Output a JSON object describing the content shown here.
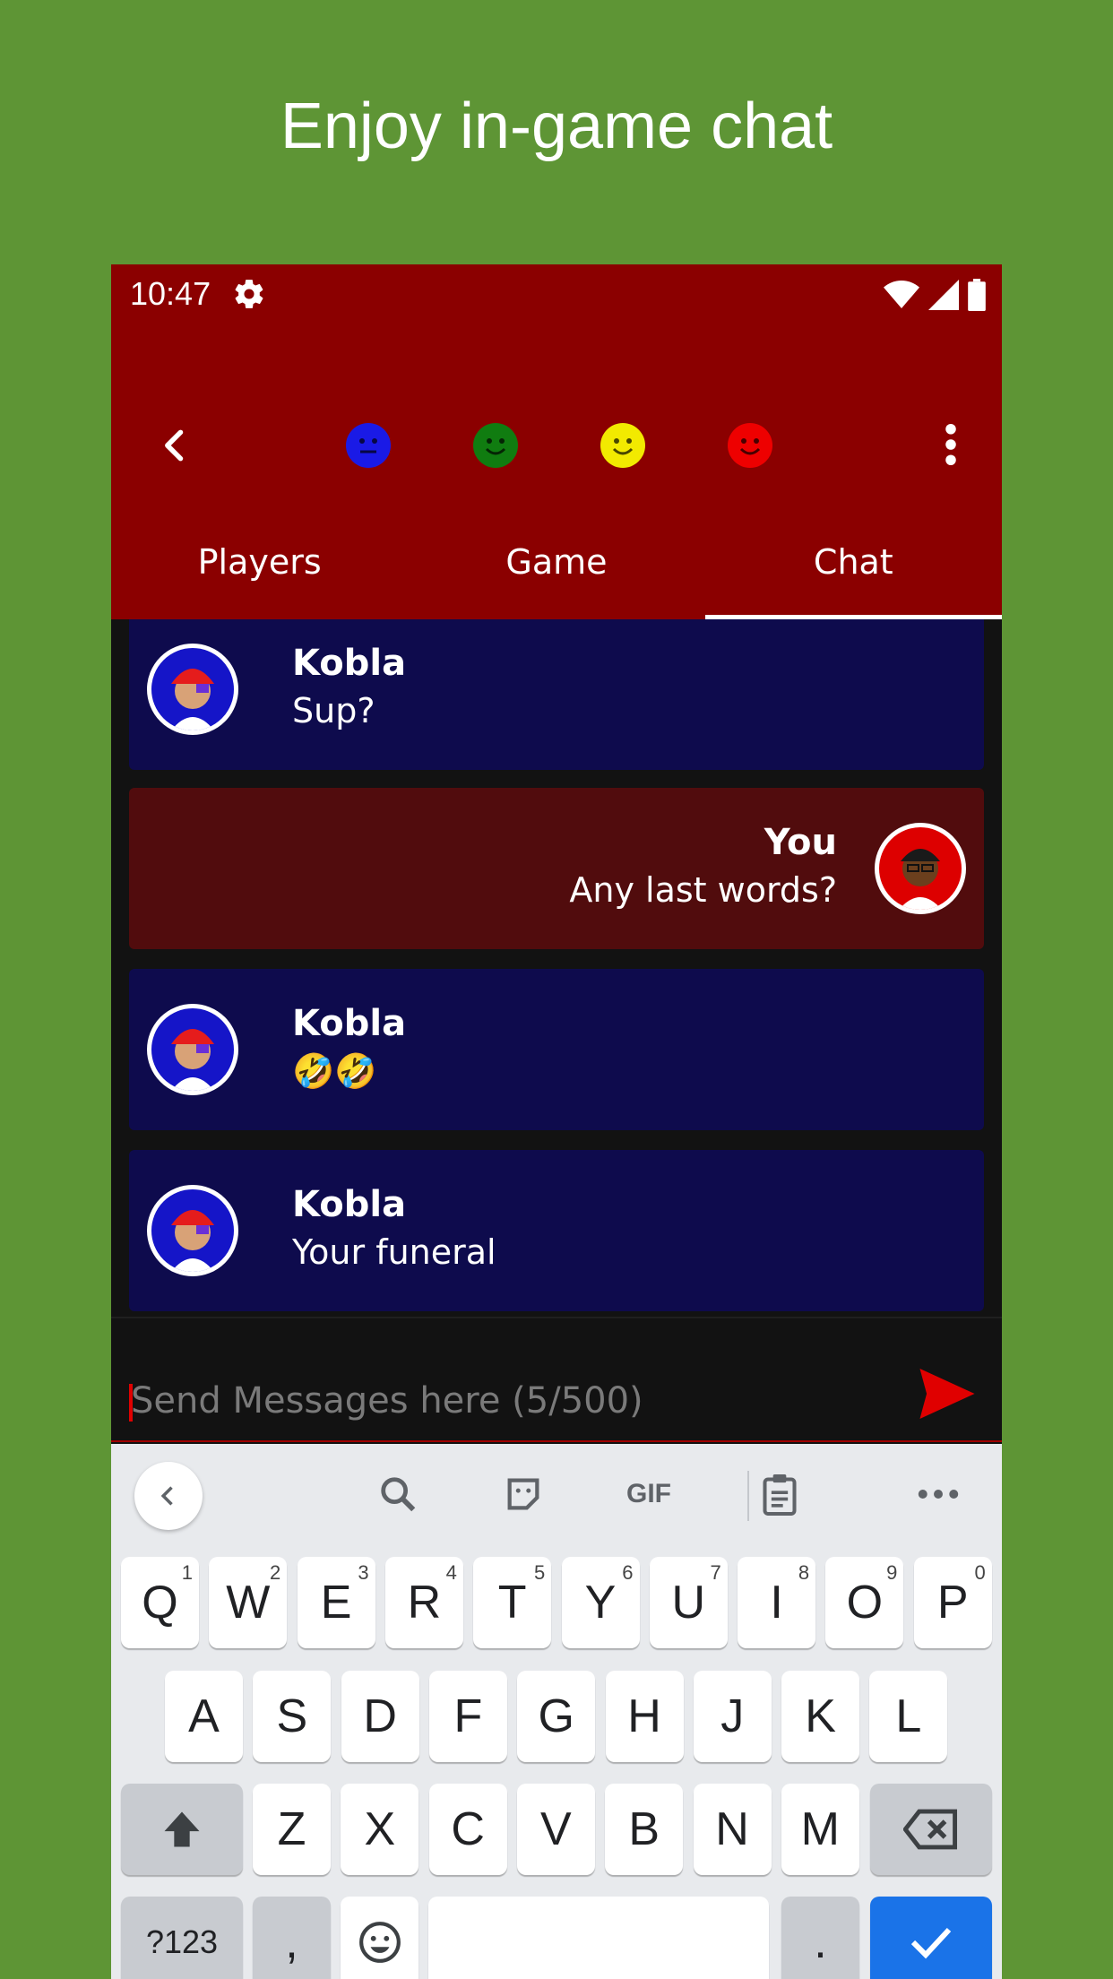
{
  "headline": "Enjoy in-game chat",
  "status": {
    "time": "10:47"
  },
  "colors": {
    "appbar": "#8b0000",
    "background": "#5e9535",
    "other_bubble": "#0e0b4d",
    "my_bubble": "#510c0d",
    "send": "#e00000"
  },
  "players_faces": [
    {
      "color": "#1a1ae6",
      "icon": "neutral-face-icon"
    },
    {
      "color": "#107c10",
      "icon": "smile-face-icon"
    },
    {
      "color": "#f2ea00",
      "icon": "smile-face-icon"
    },
    {
      "color": "#ee0000",
      "icon": "smile-face-icon"
    }
  ],
  "tabs": [
    {
      "label": "Players"
    },
    {
      "label": "Game"
    },
    {
      "label": "Chat",
      "active": true
    }
  ],
  "messages": [
    {
      "sender": "Kobla",
      "text": "Sup?",
      "mine": false
    },
    {
      "sender": "You",
      "text": "Any last words?",
      "mine": true
    },
    {
      "sender": "Kobla",
      "text": "🤣🤣",
      "mine": false
    },
    {
      "sender": "Kobla",
      "text": "Your funeral",
      "mine": false
    }
  ],
  "input": {
    "placeholder": "Send Messages here (5/500)"
  },
  "keyboard": {
    "toolbar_gif": "GIF",
    "row1": [
      "Q",
      "W",
      "E",
      "R",
      "T",
      "Y",
      "U",
      "I",
      "O",
      "P"
    ],
    "row1_numbers": [
      "1",
      "2",
      "3",
      "4",
      "5",
      "6",
      "7",
      "8",
      "9",
      "0"
    ],
    "row2": [
      "A",
      "S",
      "D",
      "F",
      "G",
      "H",
      "J",
      "K",
      "L"
    ],
    "row3": [
      "Z",
      "X",
      "C",
      "V",
      "B",
      "N",
      "M"
    ],
    "symbols_label": "?123",
    "comma": ",",
    "period": "."
  }
}
